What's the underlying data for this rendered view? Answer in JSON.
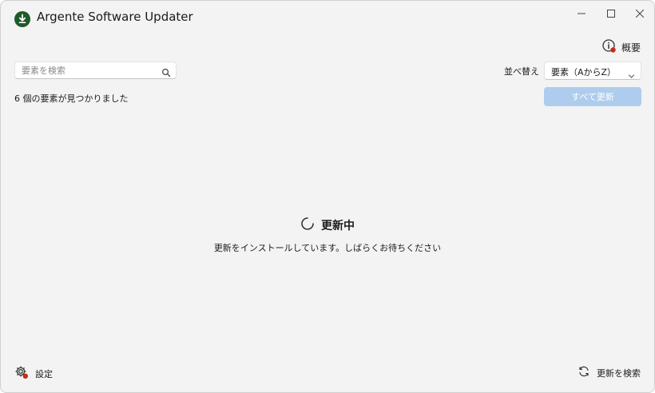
{
  "window": {
    "title": "Argente Software Updater",
    "accent": "#1e5a2a"
  },
  "header": {
    "about_label": "概要"
  },
  "toolbar": {
    "search_placeholder": "要素を検索",
    "sort_label": "並べ替え",
    "sort_value": "要素（AからZ）",
    "update_all_label": "すべて更新",
    "update_all_color": "#aecdee"
  },
  "results": {
    "count_text": "6 個の要素が見つかりました"
  },
  "status": {
    "title": "更新中",
    "subtitle": "更新をインストールしています。しばらくお待ちください"
  },
  "footer": {
    "settings_label": "設定",
    "check_updates_label": "更新を検索",
    "badge_color": "#c42b1c"
  },
  "icons": [
    "download-icon",
    "minimize-icon",
    "maximize-icon",
    "close-icon",
    "info-icon",
    "search-icon",
    "chevron-down-icon",
    "spinner-icon",
    "gear-icon",
    "refresh-icon"
  ]
}
